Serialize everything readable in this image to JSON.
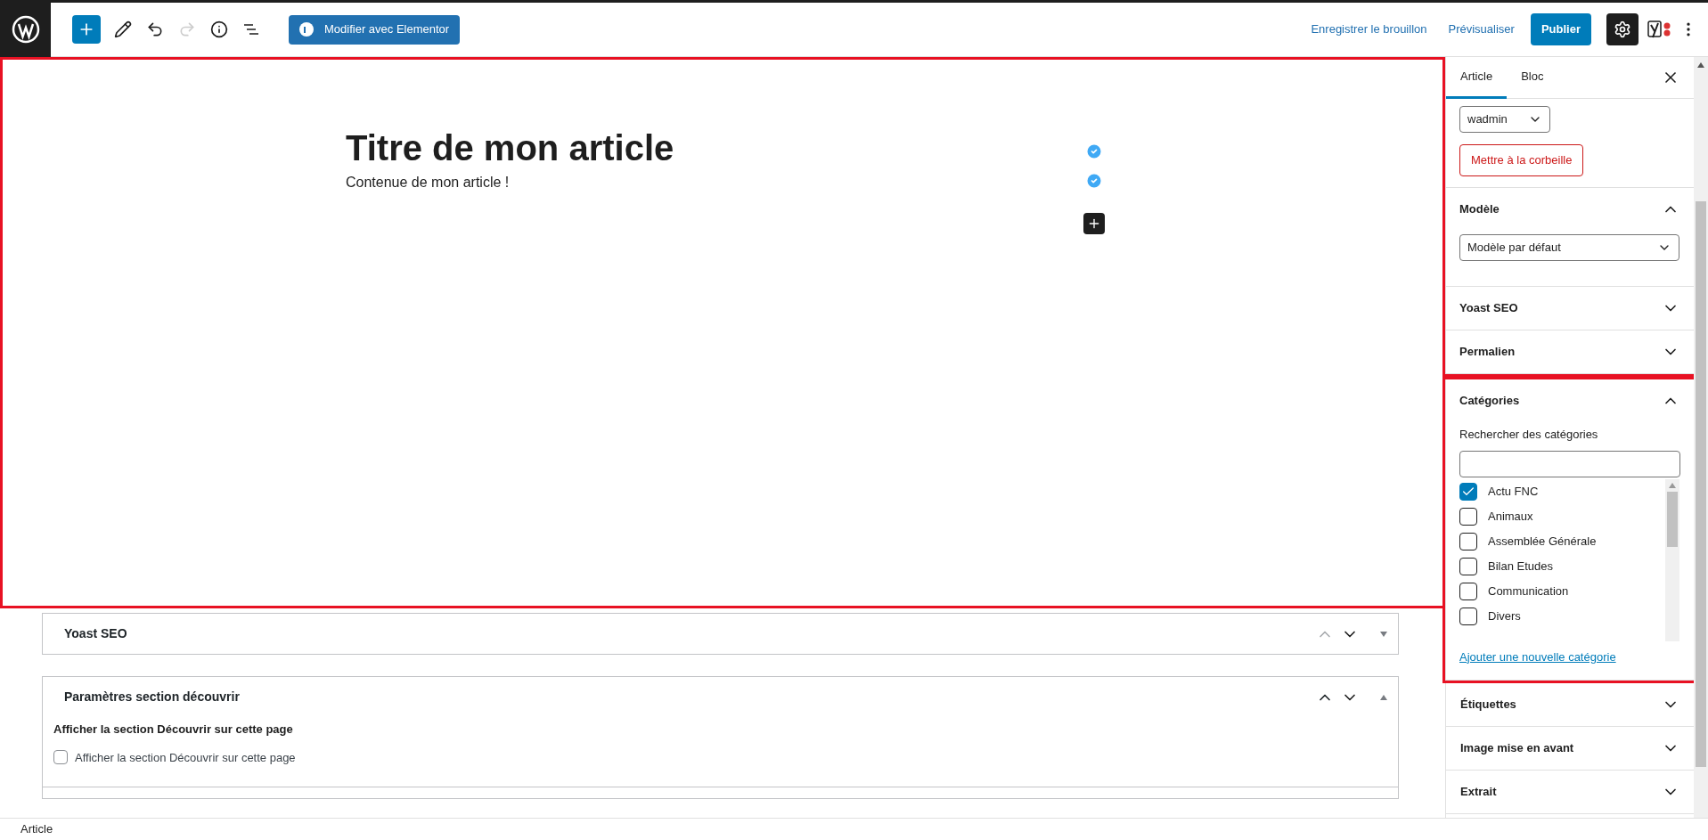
{
  "toolbar": {
    "elementor_button": "Modifier avec Elementor",
    "save_draft": "Enregistrer le brouillon",
    "preview": "Prévisualiser",
    "publish": "Publier"
  },
  "editor": {
    "title": "Titre de mon article",
    "paragraph": "Contenue de mon article !"
  },
  "metaboxes": [
    {
      "title": "Yoast SEO",
      "expanded": false
    },
    {
      "title": "Paramètres section découvrir",
      "expanded": true,
      "field_label": "Afficher la section Découvrir sur cette page",
      "checkbox": {
        "label": "Afficher la section Découvrir sur cette page",
        "checked": false
      }
    }
  ],
  "sidebar": {
    "tabs": [
      {
        "label": "Article",
        "selected": true
      },
      {
        "label": "Bloc",
        "selected": false
      }
    ],
    "author": "wadmin",
    "trash_button": "Mettre à la corbeille",
    "panels": [
      {
        "title": "Modèle",
        "expanded": true,
        "kind": "select",
        "value": "Modèle par défaut"
      },
      {
        "title": "Yoast SEO",
        "expanded": false
      },
      {
        "title": "Permalien",
        "expanded": false
      },
      {
        "title": "Catégories",
        "expanded": true,
        "kind": "categories",
        "search_label": "Rechercher des catégories",
        "items": [
          {
            "label": "Actu FNC",
            "checked": true
          },
          {
            "label": "Animaux",
            "checked": false
          },
          {
            "label": "Assemblée Générale",
            "checked": false
          },
          {
            "label": "Bilan Etudes",
            "checked": false
          },
          {
            "label": "Communication",
            "checked": false
          },
          {
            "label": "Divers",
            "checked": false
          }
        ],
        "add_link": "Ajouter une nouvelle catégorie"
      },
      {
        "title": "Étiquettes",
        "expanded": false
      },
      {
        "title": "Image mise en avant",
        "expanded": false
      },
      {
        "title": "Extrait",
        "expanded": false
      }
    ]
  },
  "footer": {
    "breadcrumb": "Article"
  }
}
